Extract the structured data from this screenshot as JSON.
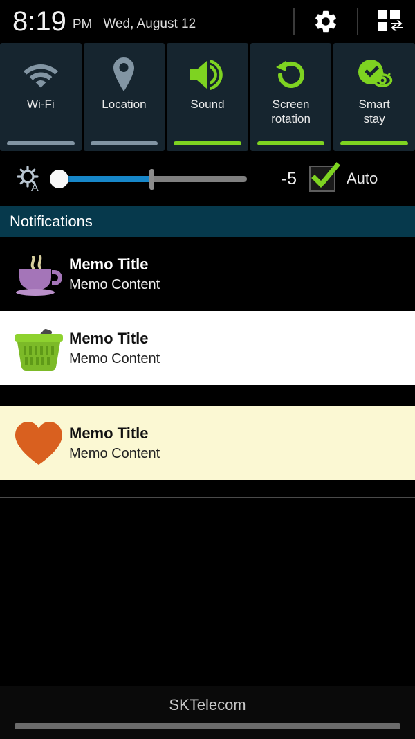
{
  "statusbar": {
    "time": "8:19",
    "ampm": "PM",
    "date": "Wed, August 12",
    "settings_icon": "gear-icon",
    "toggle_panel_icon": "grid-swap-icon"
  },
  "quick_toggles": [
    {
      "label": "Wi-Fi",
      "icon": "wifi-icon",
      "active": false,
      "color_on": "#7ed321",
      "color_off": "#8295a3"
    },
    {
      "label": "Location",
      "icon": "location-pin-icon",
      "active": false,
      "color_on": "#7ed321",
      "color_off": "#8295a3"
    },
    {
      "label": "Sound",
      "icon": "speaker-sound-icon",
      "active": true,
      "color_on": "#7ed321",
      "color_off": "#8295a3"
    },
    {
      "label": "Screen\nrotation",
      "icon": "rotate-screen-icon",
      "active": true,
      "color_on": "#7ed321",
      "color_off": "#8295a3"
    },
    {
      "label": "Smart\nstay",
      "icon": "smart-stay-eye-icon",
      "active": true,
      "color_on": "#7ed321",
      "color_off": "#8295a3"
    }
  ],
  "toggle_labels": {
    "wifi": "Wi-Fi",
    "location": "Location",
    "sound": "Sound",
    "screen_rotation_line1": "Screen",
    "screen_rotation_line2": "rotation",
    "smart_stay_line1": "Smart",
    "smart_stay_line2": "stay"
  },
  "brightness": {
    "icon": "brightness-auto-icon",
    "value": "-5",
    "auto_label": "Auto",
    "auto_checked": true,
    "slider_percent": 3,
    "fill_percent": 49,
    "fill_color": "#1787c9",
    "track_color": "#808080",
    "check_color": "#7ed321"
  },
  "notifications_header": "Notifications",
  "notifications": [
    {
      "icon": "coffee-cup-icon",
      "title": "Memo Title",
      "content": "Memo Content",
      "background": "#000000",
      "theme": "light"
    },
    {
      "icon": "shopping-basket-icon",
      "title": "Memo Title",
      "content": "Memo Content",
      "background": "#ffffff",
      "theme": "dark"
    },
    {
      "icon": "heart-icon",
      "title": "Memo Title",
      "content": "Memo Content",
      "background": "#fbf8d3",
      "theme": "dark"
    }
  ],
  "footer": {
    "carrier": "SKTelecom"
  }
}
